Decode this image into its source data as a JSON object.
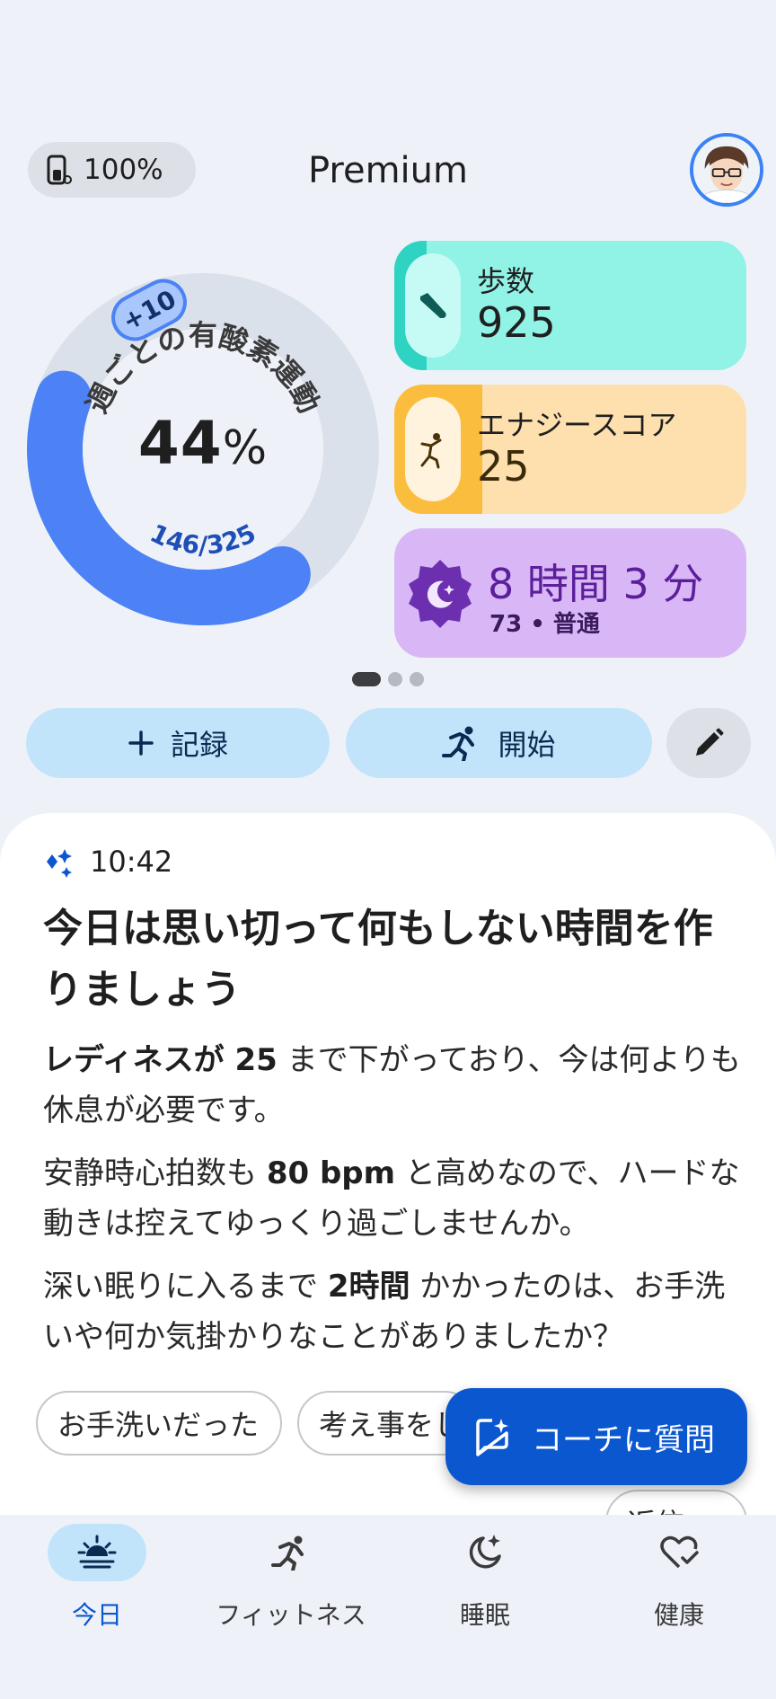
{
  "header": {
    "battery": "100%",
    "title": "Premium"
  },
  "ring": {
    "title": "週ごとの有酸素運動",
    "value": "44",
    "unit": "%",
    "bonus": "+10",
    "progress_text": "146/325",
    "progress_fraction": 0.44
  },
  "cards": {
    "steps": {
      "label": "歩数",
      "value": "925"
    },
    "energy": {
      "label": "エナジースコア",
      "value": "25"
    },
    "sleep": {
      "time": "8 時間 3 分",
      "sub": "73 • 普通"
    }
  },
  "actions": {
    "record": "記録",
    "start": "開始"
  },
  "insight": {
    "time": "10:42",
    "title": "今日は思い切って何もしない時間を作りましょう",
    "p1_bold": "レディネスが 25",
    "p1_rest": " まで下がっており、今は何よりも休息が必要です。",
    "p2_pre": "安静時心拍数も ",
    "p2_bold": "80 bpm",
    "p2_rest": " と高めなので、ハードな動きは控えてゆっくり過ごしませんか。",
    "p3_pre": "深い眠りに入るまで ",
    "p3_bold": "2時間",
    "p3_rest": " かかったのは、お手洗いや何か気掛かりなことがありましたか？"
  },
  "chips": [
    "お手洗いだった",
    "考え事をし",
    "返信"
  ],
  "fab": {
    "label": "コーチに質問"
  },
  "nav": [
    {
      "label": "今日"
    },
    {
      "label": "フィットネス"
    },
    {
      "label": "睡眠"
    },
    {
      "label": "健康"
    }
  ],
  "colors": {
    "accent": "#0b57d0",
    "ring": "#4c82f6",
    "steps": "#91f2e6",
    "energy": "#fde0ae",
    "sleep": "#d9b7f7"
  }
}
